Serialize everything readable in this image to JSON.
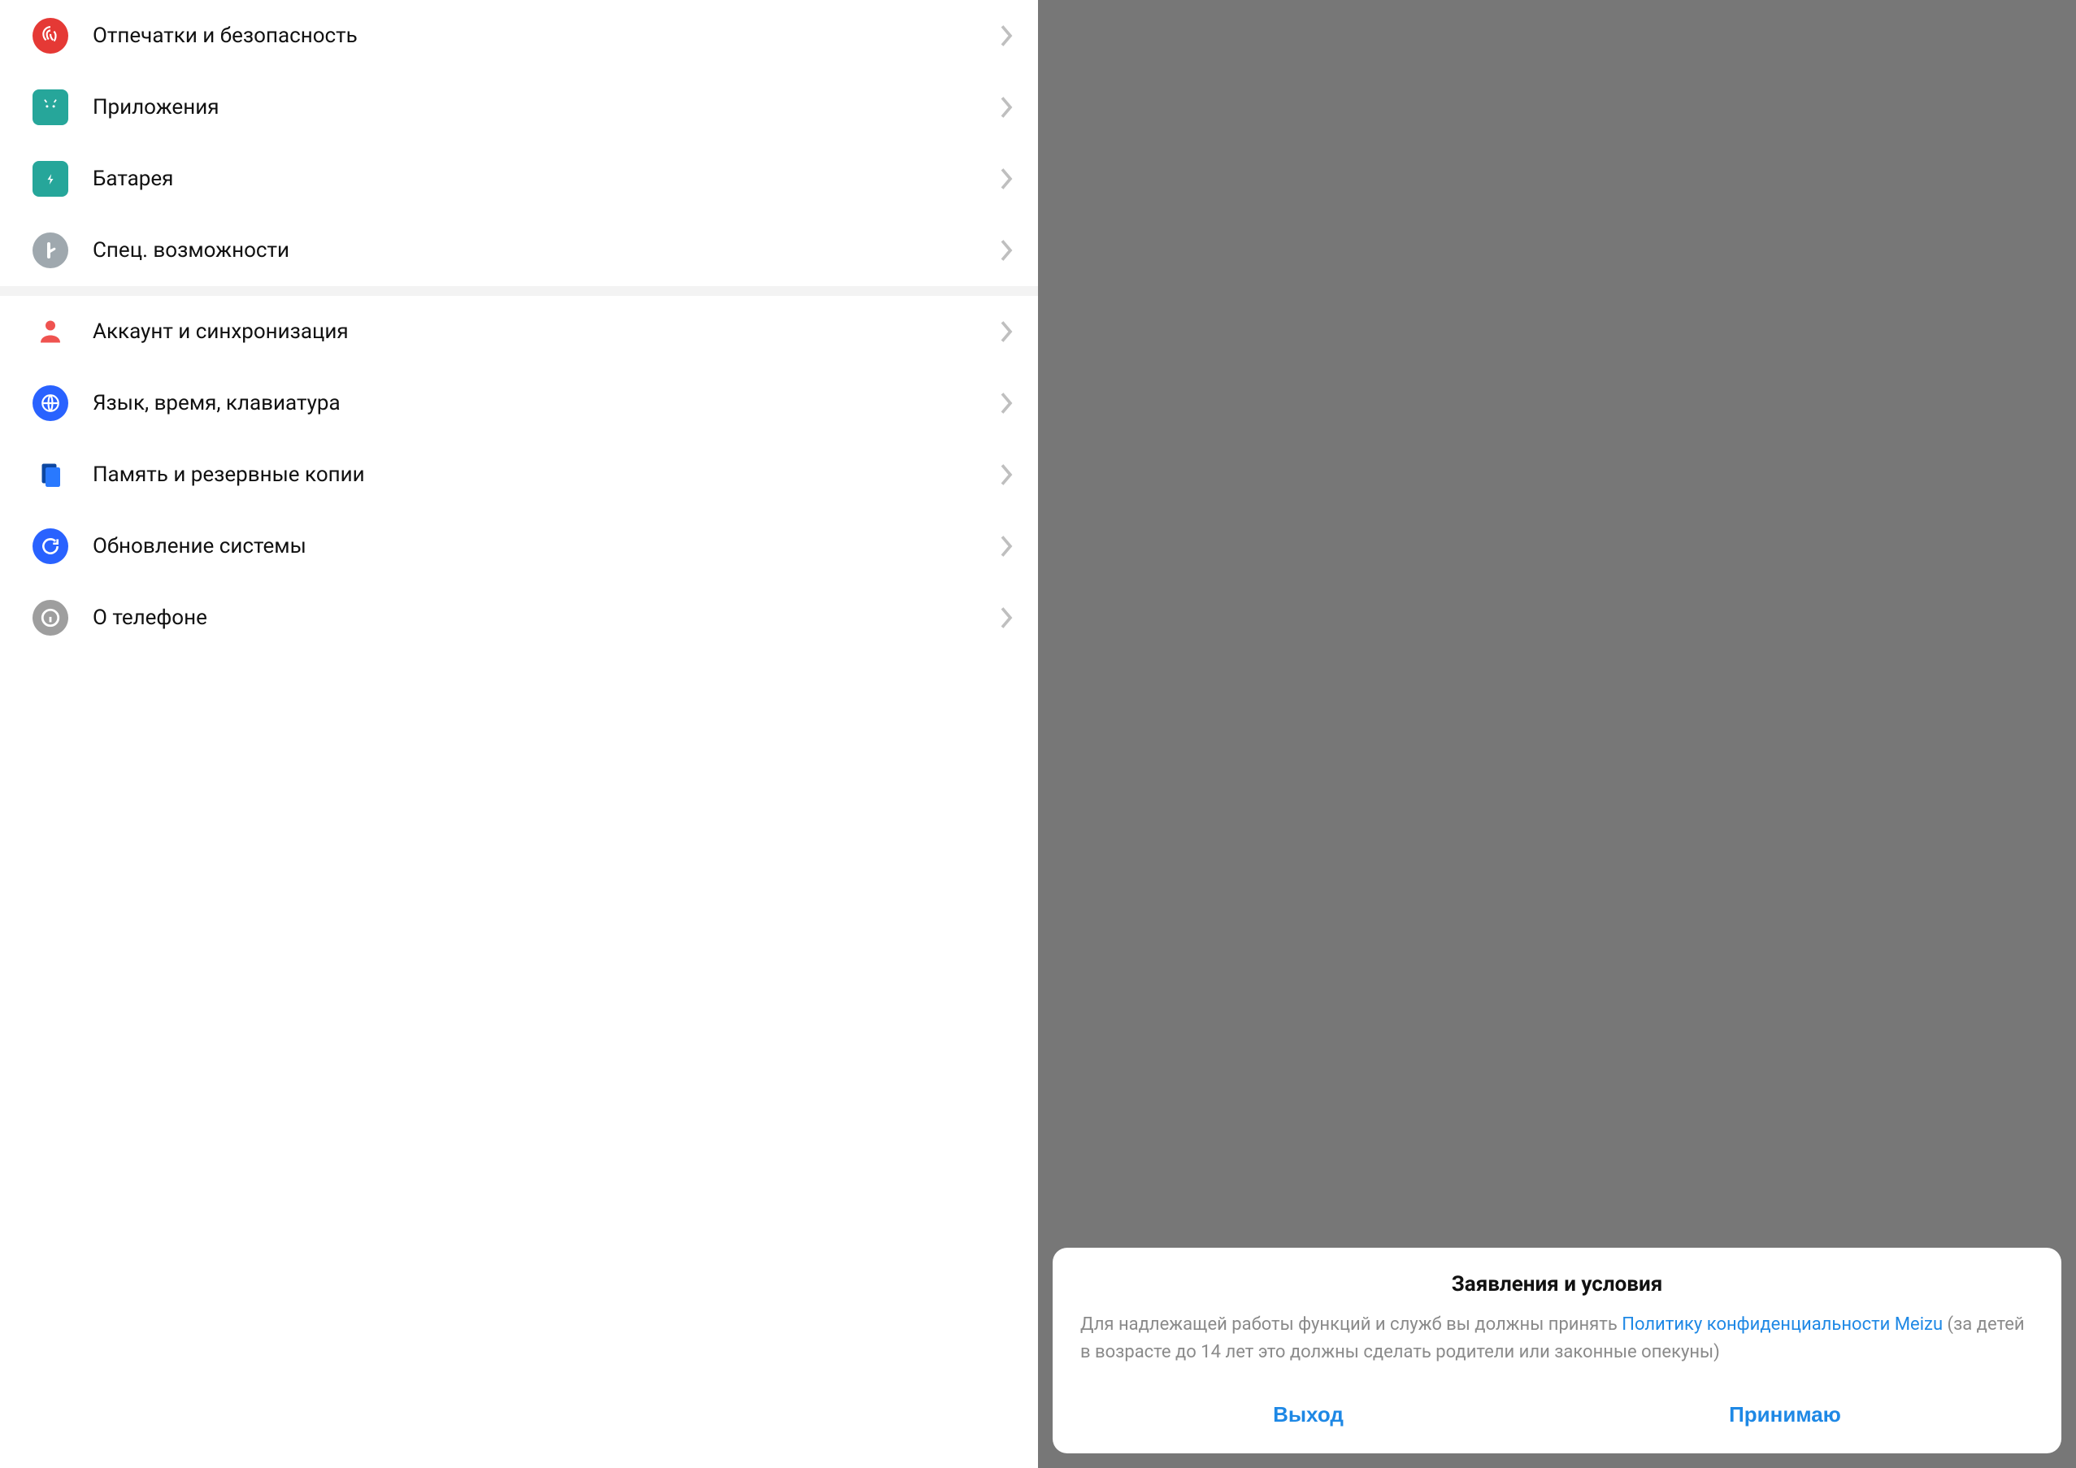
{
  "settings": {
    "groups": [
      {
        "items": [
          {
            "id": "fingerprint",
            "label": "Отпечатки и безопасность",
            "icon": "fingerprint-icon",
            "iconBg": "#e53935"
          },
          {
            "id": "apps",
            "label": "Приложения",
            "icon": "android-icon",
            "iconBg": "#26a69a"
          },
          {
            "id": "battery",
            "label": "Батарея",
            "icon": "battery-icon",
            "iconBg": "#26a69a"
          },
          {
            "id": "accessibility",
            "label": "Спец. возможности",
            "icon": "hand-icon",
            "iconBg": "#9fa8ae"
          }
        ]
      },
      {
        "items": [
          {
            "id": "account",
            "label": "Аккаунт и синхронизация",
            "icon": "person-icon",
            "iconBg": "transparent",
            "iconColor": "#ef5350"
          },
          {
            "id": "language",
            "label": "Язык, время, клавиатура",
            "icon": "globe-icon",
            "iconBg": "#2962ff"
          },
          {
            "id": "storage",
            "label": "Память и резервные копии",
            "icon": "storage-icon",
            "iconBg": "transparent",
            "iconColor": "#2962ff"
          },
          {
            "id": "update",
            "label": "Обновление системы",
            "icon": "refresh-icon",
            "iconBg": "#2962ff"
          },
          {
            "id": "about",
            "label": "О телефоне",
            "icon": "info-icon",
            "iconBg": "#9e9e9e"
          }
        ]
      }
    ]
  },
  "dialog": {
    "title": "Заявления и условия",
    "body_pre": "Для надлежащей работы функций и служб вы должны принять ",
    "body_link": "Политику конфиденциальности Meizu",
    "body_post": " (за детей в возрасте до 14 лет это должны сделать родители или законные опекуны)",
    "exit_label": "Выход",
    "accept_label": "Принимаю"
  }
}
